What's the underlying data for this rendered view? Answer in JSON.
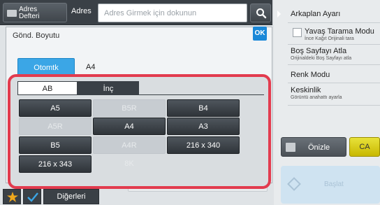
{
  "topbar": {
    "address_book_label_line1": "Adres",
    "address_book_label_line2": "Defteri",
    "address_label": "Adres",
    "address_placeholder": "Adres Girmek için dokunun"
  },
  "right_panel": {
    "title": "Arkaplan Ayarı",
    "items": [
      {
        "title": "Yavaş Tarama Modu",
        "subtitle": "İnce Kağıt Orijinali tara"
      },
      {
        "title": "Boş Sayfayı Atla",
        "subtitle": "Orijinaldeki Boş Sayfayı atla"
      },
      {
        "title": "Renk Modu",
        "subtitle": ""
      },
      {
        "title": "Keskinlik",
        "subtitle": "Görüntü anahattı ayarla"
      }
    ],
    "preview_label": "Önizle",
    "ca_label": "CA",
    "start_label": "Başlat"
  },
  "dialog": {
    "title": "Gönd. Boyutu",
    "ok_label": "OK",
    "auto_label": "Otomtk",
    "current_size": "A4"
  },
  "tabs": [
    "AB",
    "İnç"
  ],
  "sizes": [
    {
      "label": "A5",
      "enabled": true
    },
    {
      "label": "B5R",
      "enabled": false
    },
    {
      "label": "B4",
      "enabled": true
    },
    {
      "label": "A5R",
      "enabled": false
    },
    {
      "label": "A4",
      "enabled": true
    },
    {
      "label": "A3",
      "enabled": true
    },
    {
      "label": "B5",
      "enabled": true
    },
    {
      "label": "A4R",
      "enabled": false
    },
    {
      "label": "216 x 340",
      "enabled": true
    },
    {
      "label": "216 x 343",
      "enabled": true
    },
    {
      "label": "8K",
      "enabled": false
    }
  ],
  "bottombar": {
    "others_label": "Diğerleri"
  },
  "colors": {
    "accent_blue": "#3ba6e6",
    "highlight_red": "#e23b4e",
    "ca_yellow": "#e0d620",
    "dark_button": "#3a4046"
  }
}
